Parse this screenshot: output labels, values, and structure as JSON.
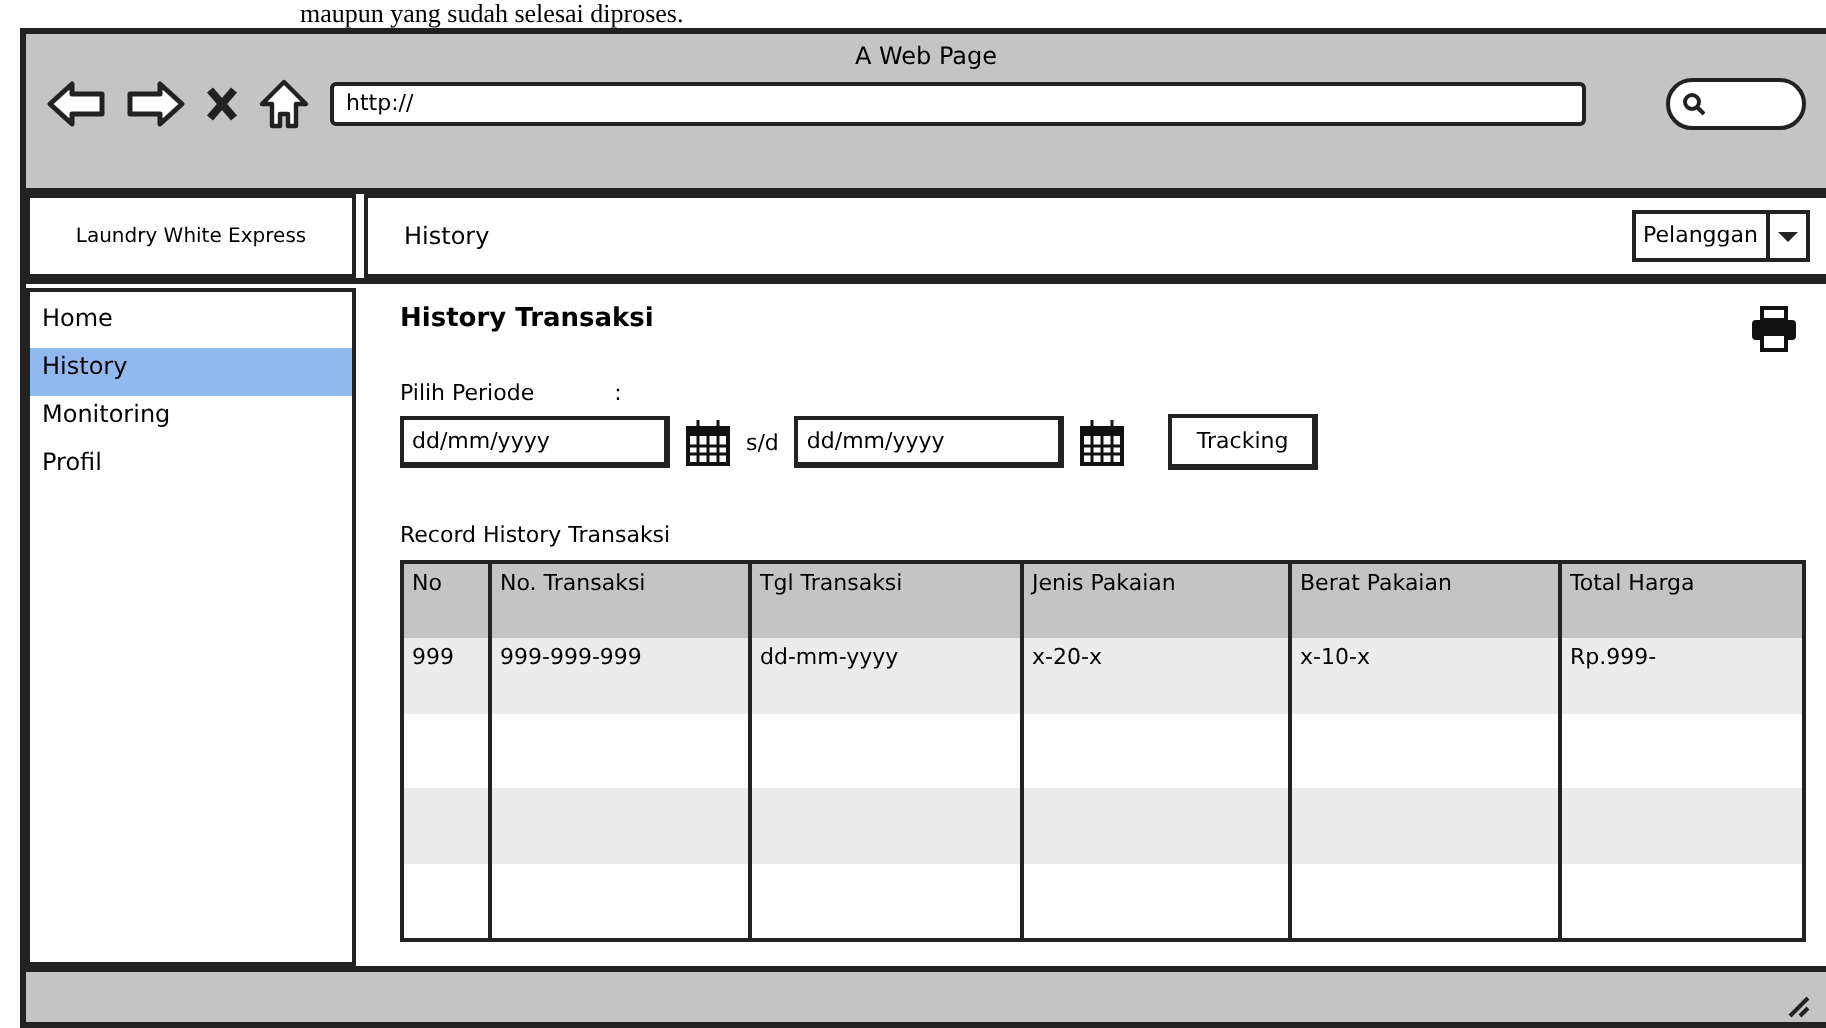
{
  "document_text": "maupun yang sudah selesai diproses.",
  "window": {
    "title": "A Web Page",
    "url": "http://"
  },
  "brand": "Laundry White Express",
  "breadcrumb": "History",
  "role_select": {
    "value": "Pelanggan"
  },
  "sidebar": {
    "items": [
      {
        "label": "Home",
        "selected": false
      },
      {
        "label": "History",
        "selected": true
      },
      {
        "label": "Monitoring",
        "selected": false
      },
      {
        "label": "Profil",
        "selected": false
      }
    ]
  },
  "page_title": "History Transaksi",
  "period": {
    "label": "Pilih Periode",
    "colon": ":",
    "from_placeholder": "dd/mm/yyyy",
    "separator": "s/d",
    "to_placeholder": "dd/mm/yyyy",
    "button": "Tracking"
  },
  "table": {
    "title": "Record History Transaksi",
    "columns": [
      "No",
      "No. Transaksi",
      "Tgl Transaksi",
      "Jenis Pakaian",
      "Berat Pakaian",
      "Total Harga"
    ],
    "rows": [
      [
        "999",
        "999-999-999",
        "dd-mm-yyyy",
        "x-20-x",
        "x-10-x",
        "Rp.999-"
      ]
    ]
  }
}
